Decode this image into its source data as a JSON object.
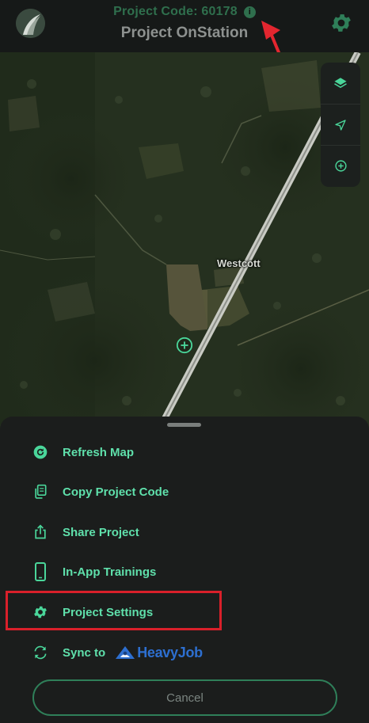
{
  "header": {
    "project_code": "Project Code: 60178",
    "info_glyph": "i",
    "project_title": "Project OnStation",
    "settings_icon": "gear-icon",
    "logo": "app-logo"
  },
  "map": {
    "place_label": "Westcott",
    "controls": [
      "layers-icon",
      "location-arrow-icon",
      "add-point-icon"
    ]
  },
  "sheet": {
    "items": [
      {
        "label": "Refresh Map",
        "icon": "refresh-icon"
      },
      {
        "label": "Copy Project Code",
        "icon": "copy-icon"
      },
      {
        "label": "Share Project",
        "icon": "share-icon"
      },
      {
        "label": "In-App Trainings",
        "icon": "phone-icon"
      },
      {
        "label": "Project Settings",
        "icon": "gear-icon"
      },
      {
        "label": "Sync to",
        "icon": "sync-icon"
      }
    ],
    "sync_brand": "HeavyJob",
    "cancel_label": "Cancel"
  },
  "colors": {
    "accent_green": "#5fe0ab",
    "highlight_red": "#d9202a",
    "brand_blue": "#2d6fd0"
  }
}
